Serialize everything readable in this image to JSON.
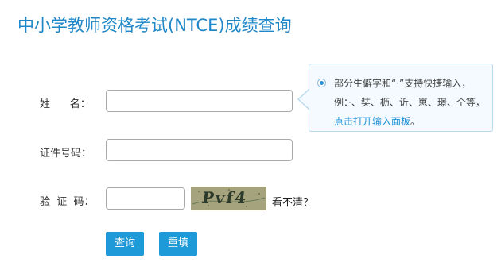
{
  "page": {
    "title": "中小学教师资格考试(NTCE)成绩查询"
  },
  "form": {
    "name_label": "姓      名：",
    "id_label": "证件号码：",
    "captcha_label": "验  证  码：",
    "name_value": "",
    "id_value": "",
    "captcha_value": "",
    "captcha_image_text": "Pvf4",
    "cant_see_label": "看不清？"
  },
  "tooltip": {
    "text": "部分生僻字和“·”支持快捷输入，例：·、奘、枥、䜣、崽、璟、仝等，",
    "link_text": "点击打开输入面板",
    "end_punct": "。"
  },
  "buttons": {
    "query_label": "查询",
    "reset_label": "重填"
  },
  "colors": {
    "title": "#1f87c8",
    "button_bg": "#1f9ad8",
    "link": "#1a8fd6",
    "tooltip_border": "#b8d9ee",
    "tooltip_bg": "#f4faff"
  }
}
